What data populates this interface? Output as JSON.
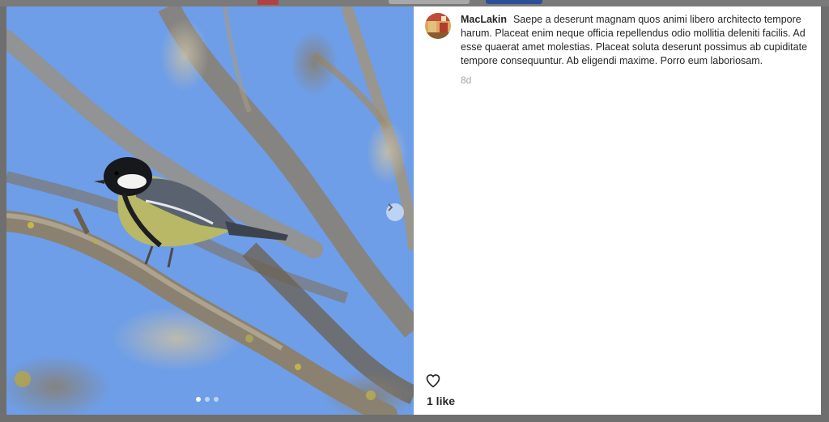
{
  "post": {
    "username": "MacLakin",
    "caption": "Saepe a deserunt magnam quos animi libero architecto tempore harum. Placeat enim neque officia repellendus odio mollitia deleniti facilis. Ad esse quaerat amet molestias. Placeat soluta deserunt possimus ab cupiditate tempore consequuntur. Ab eligendi maxime. Porro eum laboriosam.",
    "timestamp": "8d",
    "likes_label": "1 like",
    "carousel": {
      "slide_count": 3,
      "active_index": 0
    }
  },
  "icons": {
    "next": "chevron-right-icon",
    "like": "heart-outline-icon"
  },
  "colors": {
    "sky": "#6e9ee8",
    "overlay": "#6f6f6f",
    "text": "#262626",
    "muted": "#a3a3a3"
  }
}
